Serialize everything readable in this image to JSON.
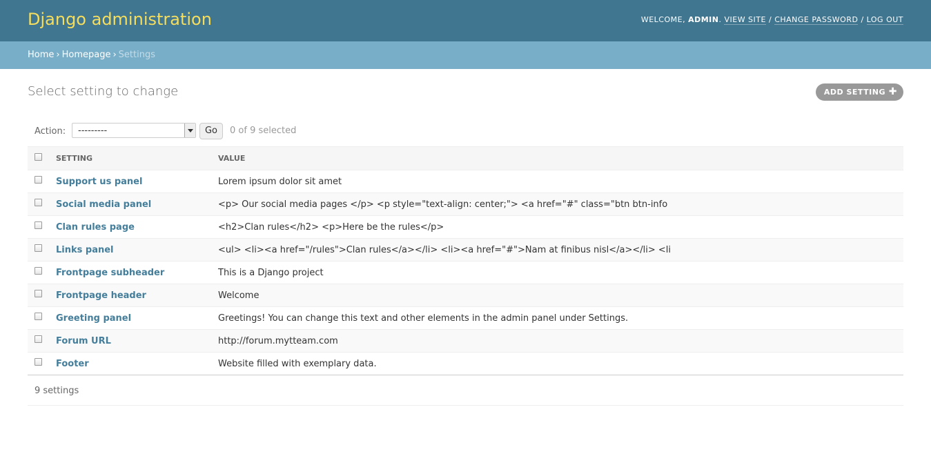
{
  "header": {
    "branding": "Django administration",
    "user_tools": {
      "welcome": "Welcome,",
      "username": "admin",
      "view_site": "View site",
      "change_password": "Change password",
      "log_out": "Log out",
      "separator": "/"
    }
  },
  "breadcrumbs": {
    "home": "Home",
    "homepage": "Homepage",
    "current": "Settings",
    "separator": "›"
  },
  "main": {
    "title": "Select setting to change",
    "add_button": "Add setting",
    "add_icon": "plus-icon"
  },
  "actions": {
    "label": "Action:",
    "select_value": "---------",
    "go_label": "Go",
    "selected_text": "0 of 9 selected"
  },
  "table": {
    "columns": [
      "Setting",
      "Value"
    ],
    "rows": [
      {
        "setting": "Support us panel",
        "value": "Lorem ipsum dolor sit amet"
      },
      {
        "setting": "Social media panel",
        "value": "<p> Our social media pages </p> <p style=\"text-align: center;\"> <a href=\"#\" class=\"btn btn-info"
      },
      {
        "setting": "Clan rules page",
        "value": "<h2>Clan rules</h2> <p>Here be the rules</p>"
      },
      {
        "setting": "Links panel",
        "value": "<ul> <li><a href=\"/rules\">Clan rules</a></li> <li><a href=\"#\">Nam at finibus nisl</a></li> <li"
      },
      {
        "setting": "Frontpage subheader",
        "value": "This is a Django project"
      },
      {
        "setting": "Frontpage header",
        "value": "Welcome"
      },
      {
        "setting": "Greeting panel",
        "value": "Greetings! You can change this text and other elements in the admin panel under Settings."
      },
      {
        "setting": "Forum URL",
        "value": "http://forum.mytteam.com"
      },
      {
        "setting": "Footer",
        "value": "Website filled with exemplary data."
      }
    ]
  },
  "paginator": {
    "text": "9 settings"
  },
  "colors": {
    "header_bg": "#417690",
    "branding": "#f5dd5d",
    "breadcrumbs_bg": "#79aec8",
    "link": "#447e9b"
  }
}
